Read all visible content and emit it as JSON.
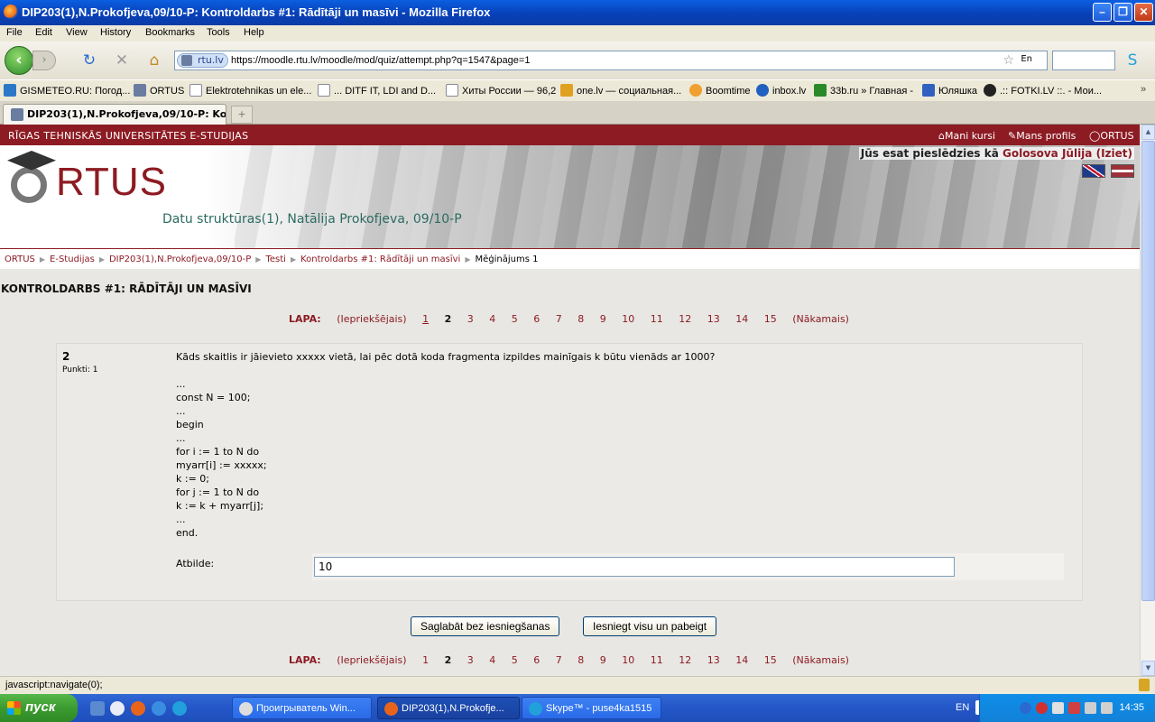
{
  "window": {
    "title": "DIP203(1),N.Prokofjeva,09/10-P: Kontroldarbs #1: Rādītāji un masīvi - Mozilla Firefox"
  },
  "menu": [
    "File",
    "Edit",
    "View",
    "History",
    "Bookmarks",
    "Tools",
    "Help"
  ],
  "nav": {
    "site_badge": "rtu.lv",
    "url": "https://moodle.rtu.lv/moodle/mod/quiz/attempt.php?q=1547&page=1",
    "lang_indicator": "En"
  },
  "bookmarks": [
    {
      "label": "GISMETEO.RU: Погод...",
      "color": "#2b78c8"
    },
    {
      "label": "ORTUS",
      "color": "#6a7ca0"
    },
    {
      "label": "Elektrotehnikas un ele...",
      "color": "#ffffff"
    },
    {
      "label": "... DITF IT, LDI and D...",
      "color": "#ffffff"
    },
    {
      "label": "Хиты России — 96,2",
      "color": "#ffffff"
    },
    {
      "label": "one.lv — социальная...",
      "color": "#e0a020"
    },
    {
      "label": "Boomtime",
      "color": "#f0a030"
    },
    {
      "label": "inbox.lv",
      "color": "#2060c0"
    },
    {
      "label": "33b.ru » Главная -",
      "color": "#2a8a2a"
    },
    {
      "label": "Юляшка",
      "color": "#3060c0"
    },
    {
      "label": ".:: FOTKI.LV ::. - Мои...",
      "color": "#222222"
    }
  ],
  "tab": {
    "label": "DIP203(1),N.Prokofjeva,09/10-P: Ko..."
  },
  "site": {
    "university": "RĪGAS TEHNISKĀS UNIVERSITĀTES E-STUDIJAS",
    "top_links": [
      "Mani kursi",
      "Mans profils",
      "ORTUS"
    ],
    "logo_text": "RTUS",
    "course_name": "Datu struktūras(1), Natālija Prokofjeva, 09/10-P",
    "logged_in_prefix": "Jūs esat pieslēdzies kā",
    "user_name": "Golosova Jūlija",
    "logout": "(Iziet)"
  },
  "breadcrumb": [
    "ORTUS",
    "E-Studijas",
    "DIP203(1),N.Prokofjeva,09/10-P",
    "Testi",
    "Kontroldarbs #1: Rādītāji un masīvi",
    "Mēģinājums 1"
  ],
  "quiz": {
    "title": "KONTROLDARBS #1: RĀDĪTĀJI UN MASĪVI",
    "pager": {
      "label": "LAPA:",
      "prev": "(Iepriekšējais)",
      "pages": [
        "1",
        "2",
        "3",
        "4",
        "5",
        "6",
        "7",
        "8",
        "9",
        "10",
        "11",
        "12",
        "13",
        "14",
        "15"
      ],
      "current": "2",
      "next": "(Nākamais)"
    },
    "question": {
      "number": "2",
      "points": "Punkti: 1",
      "text": "Kāds skaitlis ir jāievieto xxxxx vietā, lai pēc dotā koda fragmenta izpildes mainīgais k būtu vienāds ar 1000?",
      "code": "...\nconst N = 100;\n...\nbegin\n...\nfor i := 1 to N do\nmyarr[i] := xxxxx;\nk := 0;\nfor j := 1 to N do\nk := k + myarr[j];\n...\nend.",
      "answer_label": "Atbilde:",
      "answer_value": "10"
    },
    "buttons": {
      "save": "Saglabāt bez iesniegšanas",
      "submit": "Iesniegt visu un pabeigt"
    }
  },
  "status": "javascript:navigate(0);",
  "taskbar": {
    "start": "пуск",
    "tasks": [
      "Проигрыватель Win...",
      "DIP203(1),N.Prokofje...",
      "Skype™ - puse4ka1515"
    ],
    "lang": "EN",
    "clock": "14:35"
  }
}
